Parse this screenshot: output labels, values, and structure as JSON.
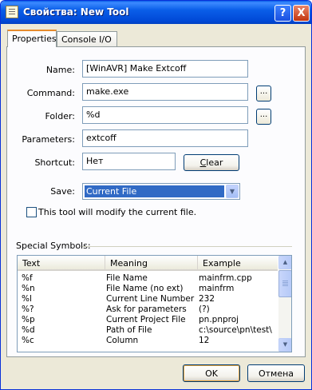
{
  "window": {
    "title": "Свойства: New Tool",
    "help_glyph": "?",
    "close_glyph": "X"
  },
  "tabs": [
    {
      "label": "Properties",
      "selected": true
    },
    {
      "label": "Console I/O",
      "selected": false
    }
  ],
  "form": {
    "name_label": "Name:",
    "name_value": "[WinAVR] Make Extcoff",
    "command_label": "Command:",
    "command_value": "make.exe",
    "folder_label": "Folder:",
    "folder_value": "%d",
    "parameters_label": "Parameters:",
    "parameters_value": "extcoff",
    "shortcut_label": "Shortcut:",
    "shortcut_value": "Нет",
    "clear_button_prefix": "",
    "clear_button_accel": "C",
    "clear_button_rest": "lear",
    "browse_label": "...",
    "save_label": "Save:",
    "save_value": "Current File",
    "modify_checkbox_label": "This tool will modify the current file.",
    "modify_checked": false
  },
  "special_symbols": {
    "group_label": "Special Symbols:",
    "columns": [
      "Text",
      "Meaning",
      "Example"
    ],
    "rows": [
      [
        "%f",
        "File Name",
        "mainfrm.cpp"
      ],
      [
        "%n",
        "File Name (no ext)",
        "mainfrm"
      ],
      [
        "%l",
        "Current Line Number",
        "232"
      ],
      [
        "%?",
        "Ask for parameters",
        "(?)"
      ],
      [
        "%p",
        "Current Project File",
        "pn.pnproj"
      ],
      [
        "%d",
        "Path of File",
        "c:\\source\\pn\\test\\"
      ],
      [
        "%c",
        "Column",
        "12"
      ]
    ]
  },
  "footer": {
    "ok_label": "OK",
    "cancel_label": "Отмена"
  },
  "colors": {
    "titlebar": "#0a5ee8",
    "selection": "#316ac5",
    "dialog_bg": "#ece9d8"
  }
}
